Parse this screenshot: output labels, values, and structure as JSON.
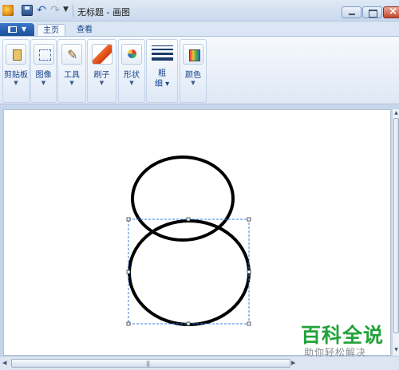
{
  "window": {
    "title": "无标题 - 画图"
  },
  "ribbon": {
    "tabs": [
      {
        "label": "主页",
        "active": true
      },
      {
        "label": "查看",
        "active": false
      }
    ],
    "groups": {
      "clipboard": "剪贴板",
      "image": "图像",
      "tools": "工具",
      "brushes": "刷子",
      "shapes": "形状",
      "size_line1": "粗",
      "size_line2": "细",
      "colors": "颜色"
    }
  },
  "icons": {
    "app": "paint-app-icon",
    "save": "save-icon",
    "undo": "undo-icon",
    "redo": "redo-icon"
  },
  "watermark": {
    "title": "百科全说",
    "subtitle": "助你轻松解决"
  }
}
